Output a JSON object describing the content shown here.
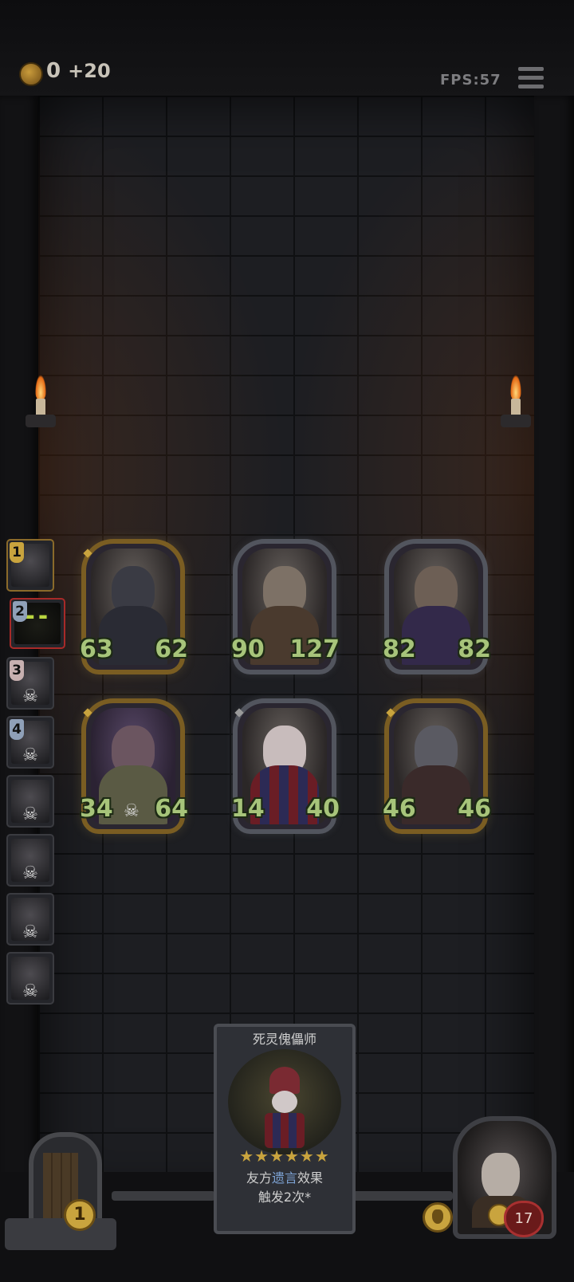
{
  "hud": {
    "gold": "0",
    "gold_income": "+20",
    "fps": "FPS:57"
  },
  "queue": [
    {
      "num": "1",
      "num_color": "#c9a43e"
    },
    {
      "num": "2",
      "num_color": "#8fa0b8"
    },
    {
      "num": "3",
      "num_color": "#c7b0b0"
    },
    {
      "num": "4",
      "num_color": "#8fa0b8"
    },
    {
      "num": ""
    },
    {
      "num": ""
    },
    {
      "num": ""
    },
    {
      "num": ""
    }
  ],
  "board": [
    {
      "atk": "63",
      "hp": "62",
      "frame": "gold"
    },
    {
      "atk": "90",
      "hp": "127",
      "frame": "silver"
    },
    {
      "atk": "82",
      "hp": "82",
      "frame": "silver"
    },
    {
      "atk": "34",
      "hp": "64",
      "frame": "gold"
    },
    {
      "atk": "14",
      "hp": "40",
      "frame": "silver"
    },
    {
      "atk": "46",
      "hp": "46",
      "frame": "gold"
    }
  ],
  "featured": {
    "name": "死灵傀儡师",
    "stars": "★★★★★★",
    "desc_prefix": "友方",
    "desc_keyword": "遗言",
    "desc_suffix": "效果",
    "desc_line2": "触发2次*"
  },
  "gate_count": "1",
  "hero_hp": "17",
  "colors": {
    "gold_frame": "#7a5d22",
    "stat_green": "#a7c47a",
    "keyword_blue": "#7ea4d6"
  }
}
